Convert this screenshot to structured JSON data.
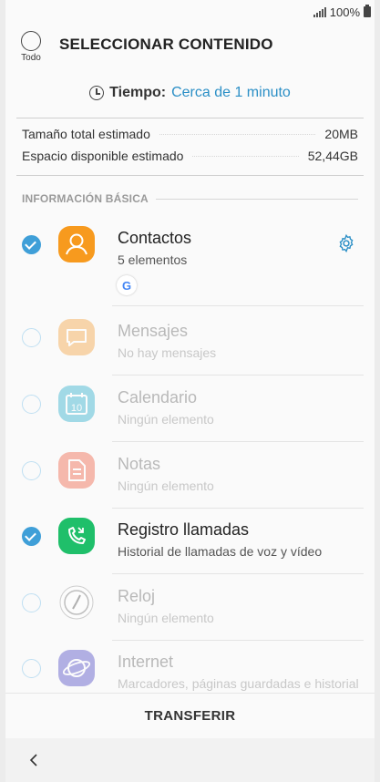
{
  "status": {
    "battery": "100%"
  },
  "header": {
    "all_label": "Todo",
    "title": "SELECCIONAR CONTENIDO"
  },
  "time": {
    "label": "Tiempo:",
    "value": "Cerca de 1 minuto"
  },
  "sizes": {
    "total_label": "Tamaño total estimado",
    "total_value": "20MB",
    "free_label": "Espacio disponible estimado",
    "free_value": "52,44GB"
  },
  "section_title": "INFORMACIÓN BÁSICA",
  "items": [
    {
      "title": "Contactos",
      "subtitle": "5 elementos",
      "checked": true,
      "icon": "contacts-icon",
      "color": "#f79a1e"
    },
    {
      "title": "Mensajes",
      "subtitle": "No hay mensajes",
      "checked": false,
      "icon": "messages-icon",
      "color": "#f5a84a"
    },
    {
      "title": "Calendario",
      "subtitle": "Ningún elemento",
      "checked": false,
      "icon": "calendar-icon",
      "color": "#37b2cf",
      "calendar_day": "10"
    },
    {
      "title": "Notas",
      "subtitle": "Ningún elemento",
      "checked": false,
      "icon": "notes-icon",
      "color": "#ef6a4f"
    },
    {
      "title": "Registro llamadas",
      "subtitle": "Historial de llamadas de voz y vídeo",
      "checked": true,
      "icon": "call-log-icon",
      "color": "#1fbf6a"
    },
    {
      "title": "Reloj",
      "subtitle": "Ningún elemento",
      "checked": false,
      "icon": "clock-app-icon",
      "color": "#ffffff"
    },
    {
      "title": "Internet",
      "subtitle": "Marcadores, páginas guardadas e historial",
      "checked": false,
      "icon": "internet-icon",
      "color": "#5b55c9"
    }
  ],
  "google_badge": "G",
  "bottom_action": "TRANSFERIR",
  "colors": {
    "accent": "#3f9fd8",
    "link": "#2b8fc6"
  }
}
